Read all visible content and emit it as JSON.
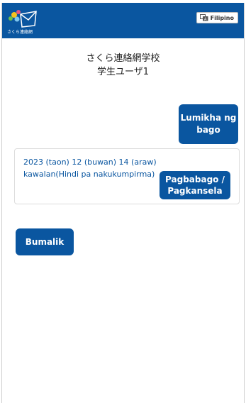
{
  "header": {
    "logo_text": "さくら連絡網",
    "language_button_label": "Filipino"
  },
  "school_name": "さくら連絡網学校",
  "user_name": "学生ユーザ1",
  "create_button_label": "Lumikha ng bago",
  "entry": {
    "text": "2023 (taon) 12 (buwan) 14 (araw) kawalan(Hindi pa nakukumpirma)",
    "edit_button_label": "Pagbabago / Pagkansela"
  },
  "back_button_label": "Bumalik",
  "colors": {
    "brand_blue": "#0a56a0",
    "background": "#ffffff"
  }
}
